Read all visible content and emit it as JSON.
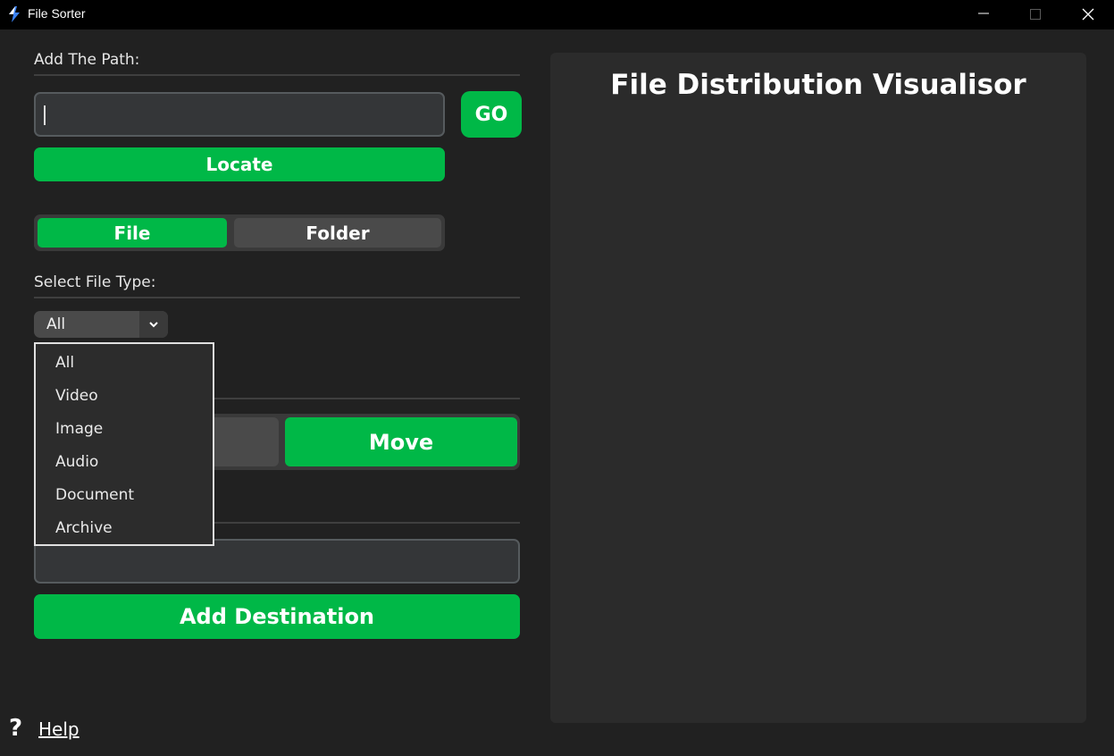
{
  "window": {
    "title": "File Sorter",
    "controls": [
      "minimize",
      "maximize",
      "close"
    ]
  },
  "path_section": {
    "label": "Add The Path:",
    "input_value": "",
    "go_label": "GO",
    "locate_label": "Locate"
  },
  "mode_toggle": {
    "options": [
      "File",
      "Folder"
    ],
    "selected": "File"
  },
  "file_type": {
    "label": "Select File Type:",
    "selected": "All",
    "options": [
      "All",
      "Video",
      "Image",
      "Audio",
      "Document",
      "Archive"
    ],
    "dropdown_open": true
  },
  "action_toggle": {
    "selected_label": "Move"
  },
  "destination": {
    "input_value": "",
    "add_label": "Add Destination"
  },
  "help": {
    "icon": "?",
    "label": "Help"
  },
  "visualizer": {
    "title": "File Distribution Visualisor"
  },
  "colors": {
    "accent": "#00b847",
    "background": "#212121",
    "panel": "#2b2b2b",
    "titlebar": "#000000"
  }
}
